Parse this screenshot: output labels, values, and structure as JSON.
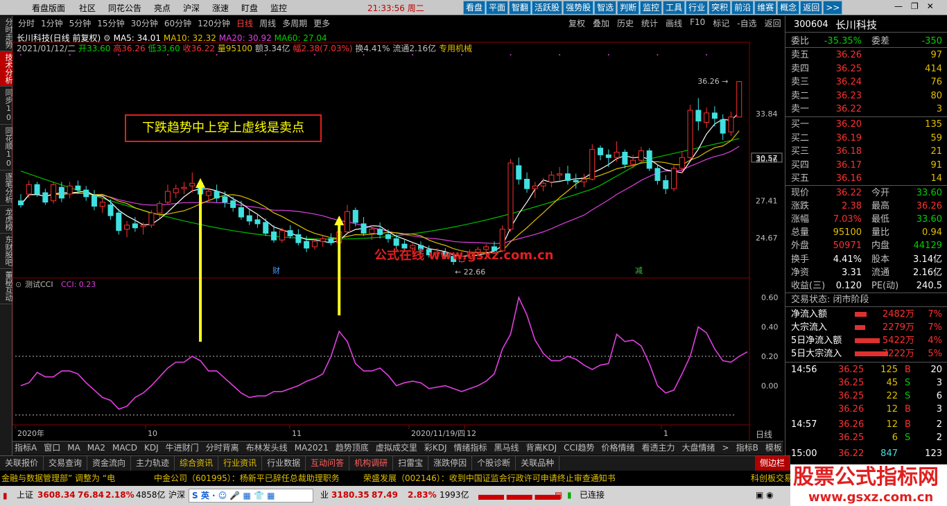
{
  "menubar": {
    "items": [
      "看盘版面",
      "社区",
      "同花公告",
      "亮点",
      "沪深",
      "涨速",
      "盯盘",
      "监控"
    ],
    "clock": "21:33:56",
    "weekday": "周二",
    "tools": [
      "看盘",
      "平面",
      "智翻",
      "活跃股",
      "强势股",
      "智选",
      "判断",
      "监控",
      "工具",
      "行业",
      "突积",
      "前沿",
      "维赛",
      "概念",
      "返回",
      ">>"
    ]
  },
  "left_strip": [
    "分时走势",
    "技术分析",
    "同步10",
    "同花顺10",
    "逐笔分析",
    "龙虎榜",
    "东财股吧",
    "董秘互动"
  ],
  "periods": [
    "分时",
    "1分钟",
    "5分钟",
    "15分钟",
    "30分钟",
    "60分钟",
    "120分钟",
    "日线",
    "周线",
    "多周期",
    "更多"
  ],
  "period_selected": "日线",
  "chart_menu": [
    "复权",
    "叠加",
    "历史",
    "统计",
    "画线",
    "F10",
    "标记",
    "-自选",
    "返回"
  ],
  "stock": {
    "name_line": "长川科技(日线 前复权)",
    "ma5": "MA5: 34.01",
    "ma10": "MA10: 32.32",
    "ma20": "MA20: 30.92",
    "ma60": "MA60: 27.04",
    "date": "2021/01/12/二",
    "open": "开33.60",
    "high": "高36.26",
    "low": "低33.60",
    "close": "收36.22",
    "volume": "量95100",
    "amount": "额3.34亿",
    "change": "幅2.38(7.03%)",
    "turnover": "换4.41%",
    "float": "流通2.16亿",
    "sector": "专用机械"
  },
  "price_axis": [
    "33.84",
    "30.57",
    "30.46",
    "27.41",
    "24.67"
  ],
  "high_label": "36.26",
  "low_label": "22.66",
  "annotation": "下跌趋势中上穿上虚线是卖点",
  "watermark1": "公式在线 www.gsxz.com.cn",
  "indicator": {
    "title": "测试CCI",
    "value": "CCI: 0.23",
    "axis": [
      "0.60",
      "0.40",
      "0.20",
      "0.00"
    ]
  },
  "event_marks": [
    "财",
    "减"
  ],
  "date_axis": [
    "2020年",
    "10",
    "11",
    "2020/11/19/四",
    "12",
    "1"
  ],
  "date_right": "日线",
  "bottom_tabs": [
    "指标A",
    "窗口",
    "MA",
    "MA2",
    "MACD",
    "KDJ",
    "牛进财门",
    "分时背离",
    "布林发头线",
    "MA2021",
    "趋势顶底",
    "虚拟成交里",
    "彩KDJ",
    "情绪指标",
    "黑马线",
    "背离KDJ",
    "CCI趋势",
    "价格情绪",
    "看透主力",
    "大盘情绪",
    ">",
    "指标B",
    "模板",
    "+",
    "−"
  ],
  "sub_bar": [
    "关联报价",
    "交易查询",
    "资金流向",
    "主力轨迹",
    "综合资讯",
    "行业资讯",
    "行业数据",
    "互动问答",
    "机构调研",
    "扫雷宝",
    "涨跌停因",
    "个股诊断",
    "关联品种",
    "侧边栏"
  ],
  "ticker": {
    "t1": "金融与数据管理部” 调整为 “电",
    "t2": "中金公司（601995）：杨新平已辞任总裁助理职务",
    "t3": "荣盛发展（002146）：收到中国证监会行政许可申请终止审查通知书",
    "t4": "科创板交易"
  },
  "status": {
    "sh_label": "上证",
    "sh_index": "3608.34",
    "sh_change": "76.84",
    "sh_pct": "2.18%",
    "sh_amount": "4858亿",
    "sz_label": "沪深",
    "cy_index": "3180.35",
    "cy_change": "87.49",
    "cy_pct": "2.83%",
    "cy_amount": "1993亿",
    "conn": "已连接",
    "cy_label": "业"
  },
  "watermark2": {
    "cn": "股票公式指标网",
    "url": "www.gsxz.com.cn"
  },
  "quote": {
    "code": "300604",
    "name": "长川科技",
    "weibi_label": "委比",
    "weibi": "-35.35%",
    "weicha_label": "委差",
    "weicha": "-350",
    "asks": [
      {
        "label": "卖五",
        "price": "36.26",
        "vol": "97"
      },
      {
        "label": "卖四",
        "price": "36.25",
        "vol": "414"
      },
      {
        "label": "卖三",
        "price": "36.24",
        "vol": "76"
      },
      {
        "label": "卖二",
        "price": "36.23",
        "vol": "80"
      },
      {
        "label": "卖一",
        "price": "36.22",
        "vol": "3"
      }
    ],
    "bids": [
      {
        "label": "买一",
        "price": "36.20",
        "vol": "135"
      },
      {
        "label": "买二",
        "price": "36.19",
        "vol": "59"
      },
      {
        "label": "买三",
        "price": "36.18",
        "vol": "21"
      },
      {
        "label": "买四",
        "price": "36.17",
        "vol": "91"
      },
      {
        "label": "买五",
        "price": "36.16",
        "vol": "14"
      }
    ],
    "stats": [
      {
        "l1": "现价",
        "v1": "36.22",
        "l2": "今开",
        "v2": "33.60"
      },
      {
        "l1": "涨跌",
        "v1": "2.38",
        "l2": "最高",
        "v2": "36.26"
      },
      {
        "l1": "涨幅",
        "v1": "7.03%",
        "l2": "最低",
        "v2": "33.60"
      },
      {
        "l1": "总量",
        "v1": "95100",
        "l2": "量比",
        "v2": "0.94"
      },
      {
        "l1": "外盘",
        "v1": "50971",
        "l2": "内盘",
        "v2": "44129"
      },
      {
        "l1": "换手",
        "v1": "4.41%",
        "l2": "股本",
        "v2": "3.14亿"
      },
      {
        "l1": "净资",
        "v1": "3.31",
        "l2": "流通",
        "v2": "2.16亿"
      },
      {
        "l1": "收益(三)",
        "v1": "0.120",
        "l2": "PE(动)",
        "v2": "240.5"
      }
    ],
    "trade_status": "交易状态: 闭市阶段",
    "flows": [
      {
        "label": "净流入额",
        "val": "2482万",
        "pct": "7%",
        "bar": 0.15
      },
      {
        "label": "大宗流入",
        "val": "2279万",
        "pct": "7%",
        "bar": 0.14
      },
      {
        "label": "5日净流入额",
        "val": "5422万",
        "pct": "4%",
        "bar": 0.33
      },
      {
        "label": "5日大宗流入",
        "val": "7222万",
        "pct": "5%",
        "bar": 0.44
      }
    ],
    "ticks": [
      {
        "time": "14:56",
        "price": "36.25",
        "vol": "125",
        "side": "B",
        "n": "20"
      },
      {
        "time": "",
        "price": "36.25",
        "vol": "45",
        "side": "S",
        "n": "3"
      },
      {
        "time": "",
        "price": "36.25",
        "vol": "22",
        "side": "S",
        "n": "6"
      },
      {
        "time": "",
        "price": "36.26",
        "vol": "12",
        "side": "B",
        "n": "3"
      },
      {
        "time": "14:57",
        "price": "36.26",
        "vol": "12",
        "side": "B",
        "n": "2"
      },
      {
        "time": "",
        "price": "36.25",
        "vol": "6",
        "side": "S",
        "n": "2"
      },
      {
        "time": "15:00",
        "price": "36.22",
        "vol": "847",
        "side": "",
        "n": "123"
      }
    ]
  },
  "chart_data": {
    "type": "candlestick",
    "title": "长川科技(日线 前复权)",
    "price_range": [
      22.0,
      38.0
    ],
    "ohlc": [
      [
        27.4,
        27.9,
        26.9,
        27.1
      ],
      [
        27.9,
        28.9,
        27.6,
        28.6
      ],
      [
        28.6,
        28.8,
        27.7,
        27.9
      ],
      [
        28.0,
        28.3,
        27.1,
        27.3
      ],
      [
        27.4,
        28.8,
        27.2,
        28.6
      ],
      [
        28.4,
        28.8,
        27.3,
        27.6
      ],
      [
        27.9,
        28.8,
        27.6,
        28.5
      ],
      [
        28.5,
        28.9,
        27.9,
        28.2
      ],
      [
        28.2,
        28.5,
        27.4,
        27.7
      ],
      [
        27.8,
        28.2,
        26.7,
        27.0
      ],
      [
        27.0,
        27.6,
        26.5,
        27.3
      ],
      [
        27.1,
        27.5,
        26.0,
        26.3
      ],
      [
        26.5,
        26.8,
        24.9,
        25.2
      ],
      [
        25.3,
        25.9,
        24.7,
        25.6
      ],
      [
        25.7,
        26.2,
        25.1,
        25.4
      ],
      [
        25.5,
        25.8,
        24.9,
        25.6
      ],
      [
        25.6,
        26.7,
        25.4,
        26.5
      ],
      [
        26.5,
        27.4,
        26.1,
        27.2
      ],
      [
        27.3,
        28.6,
        27.1,
        28.1
      ],
      [
        28.0,
        28.6,
        27.6,
        28.3
      ],
      [
        28.3,
        28.8,
        27.9,
        28.4
      ],
      [
        28.5,
        29.5,
        28.0,
        28.7
      ],
      [
        28.7,
        28.9,
        27.6,
        27.9
      ],
      [
        27.8,
        28.3,
        27.4,
        28.1
      ],
      [
        28.1,
        28.6,
        27.3,
        27.6
      ],
      [
        27.7,
        28.1,
        26.9,
        27.3
      ],
      [
        27.4,
        27.7,
        26.6,
        26.9
      ],
      [
        26.9,
        27.4,
        26.0,
        26.2
      ],
      [
        26.3,
        26.8,
        25.6,
        25.9
      ],
      [
        26.0,
        26.4,
        25.4,
        25.7
      ],
      [
        25.8,
        26.1,
        24.8,
        25.0
      ],
      [
        25.1,
        25.6,
        24.3,
        24.5
      ],
      [
        24.5,
        25.4,
        24.3,
        25.2
      ],
      [
        25.2,
        25.6,
        24.6,
        24.8
      ],
      [
        24.9,
        25.3,
        24.1,
        24.3
      ],
      [
        24.4,
        24.8,
        23.6,
        23.9
      ],
      [
        24.0,
        24.6,
        23.8,
        24.4
      ],
      [
        24.4,
        24.8,
        24.0,
        24.6
      ],
      [
        24.6,
        25.0,
        24.1,
        24.3
      ],
      [
        24.3,
        25.3,
        24.1,
        25.1
      ],
      [
        25.1,
        27.1,
        25.0,
        26.6
      ],
      [
        26.7,
        26.9,
        25.5,
        25.8
      ],
      [
        25.7,
        26.2,
        24.8,
        25.0
      ],
      [
        25.0,
        25.6,
        24.5,
        25.3
      ],
      [
        25.3,
        25.8,
        24.6,
        24.9
      ],
      [
        24.9,
        25.3,
        24.3,
        24.6
      ],
      [
        24.6,
        24.9,
        23.8,
        24.1
      ],
      [
        24.2,
        24.5,
        23.6,
        23.9
      ],
      [
        23.9,
        24.3,
        23.4,
        24.1
      ],
      [
        24.1,
        24.4,
        23.5,
        23.8
      ],
      [
        23.8,
        24.1,
        23.2,
        23.4
      ],
      [
        23.5,
        23.9,
        23.0,
        23.6
      ],
      [
        23.6,
        23.9,
        23.1,
        23.3
      ],
      [
        23.3,
        23.6,
        22.66,
        22.9
      ],
      [
        22.9,
        23.5,
        22.8,
        23.3
      ],
      [
        23.3,
        23.8,
        23.1,
        23.6
      ],
      [
        23.6,
        24.0,
        23.3,
        23.8
      ],
      [
        23.8,
        24.2,
        23.5,
        24.0
      ],
      [
        24.0,
        24.4,
        23.6,
        23.7
      ],
      [
        23.7,
        25.6,
        23.6,
        25.3
      ],
      [
        25.3,
        30.5,
        25.1,
        30.2
      ],
      [
        30.0,
        30.6,
        28.6,
        29.0
      ],
      [
        29.0,
        29.5,
        28.0,
        28.3
      ],
      [
        28.3,
        28.8,
        27.6,
        28.5
      ],
      [
        28.5,
        29.1,
        28.1,
        28.7
      ],
      [
        28.8,
        29.6,
        28.4,
        29.3
      ],
      [
        29.3,
        29.9,
        28.9,
        29.4
      ],
      [
        29.4,
        30.0,
        28.6,
        28.9
      ],
      [
        28.9,
        29.4,
        28.3,
        28.8
      ],
      [
        28.8,
        29.4,
        28.4,
        29.0
      ],
      [
        29.0,
        31.6,
        28.9,
        31.2
      ],
      [
        31.3,
        31.5,
        30.4,
        30.8
      ],
      [
        30.8,
        31.2,
        29.9,
        30.6
      ],
      [
        30.6,
        31.8,
        30.3,
        31.0
      ],
      [
        31.0,
        31.2,
        29.8,
        30.1
      ],
      [
        30.1,
        30.8,
        29.8,
        30.4
      ],
      [
        30.4,
        31.4,
        30.2,
        31.1
      ],
      [
        31.1,
        31.3,
        29.6,
        29.8
      ],
      [
        29.8,
        30.1,
        28.6,
        28.9
      ],
      [
        28.9,
        29.3,
        27.9,
        28.3
      ],
      [
        28.3,
        30.1,
        28.1,
        29.8
      ],
      [
        29.8,
        31.0,
        29.4,
        30.6
      ],
      [
        30.6,
        34.5,
        30.4,
        34.1
      ],
      [
        34.1,
        35.0,
        32.6,
        33.3
      ],
      [
        33.2,
        34.3,
        32.8,
        33.9
      ],
      [
        33.9,
        34.4,
        32.9,
        33.5
      ],
      [
        33.4,
        33.8,
        31.9,
        32.4
      ],
      [
        32.5,
        34.0,
        32.2,
        33.6
      ],
      [
        33.6,
        36.26,
        33.6,
        36.22
      ]
    ],
    "ma5_last": 34.01,
    "ma10_last": 32.32,
    "ma20_last": 30.92,
    "ma60_last": 27.04,
    "cci": [
      0.0,
      0.02,
      0.09,
      0.06,
      0.06,
      0.1,
      0.1,
      0.08,
      0.02,
      -0.03,
      -0.08,
      -0.1,
      -0.16,
      -0.14,
      -0.08,
      -0.05,
      0.0,
      0.06,
      0.12,
      0.16,
      0.16,
      0.2,
      0.17,
      0.1,
      0.1,
      0.05,
      0.0,
      -0.05,
      -0.08,
      -0.07,
      -0.07,
      -0.04,
      -0.04,
      -0.02,
      0.0,
      0.03,
      0.05,
      0.08,
      0.2,
      0.37,
      0.3,
      0.15,
      0.1,
      0.1,
      0.12,
      0.07,
      0.0,
      0.02,
      0.03,
      0.02,
      -0.02,
      -0.01,
      0.0,
      -0.02,
      -0.04,
      -0.02,
      0.0,
      0.03,
      0.08,
      0.25,
      0.35,
      0.6,
      0.48,
      0.31,
      0.22,
      0.17,
      0.17,
      0.2,
      0.18,
      0.14,
      0.11,
      0.14,
      0.15,
      0.35,
      0.3,
      0.31,
      0.27,
      0.15,
      0.0,
      -0.05,
      -0.03,
      0.08,
      0.2,
      0.4,
      0.36,
      0.25,
      0.17,
      0.16,
      0.2,
      0.23
    ],
    "cci_range": [
      -0.3,
      0.7
    ],
    "cci_dashed_levels": [
      0.2,
      -0.2
    ]
  }
}
